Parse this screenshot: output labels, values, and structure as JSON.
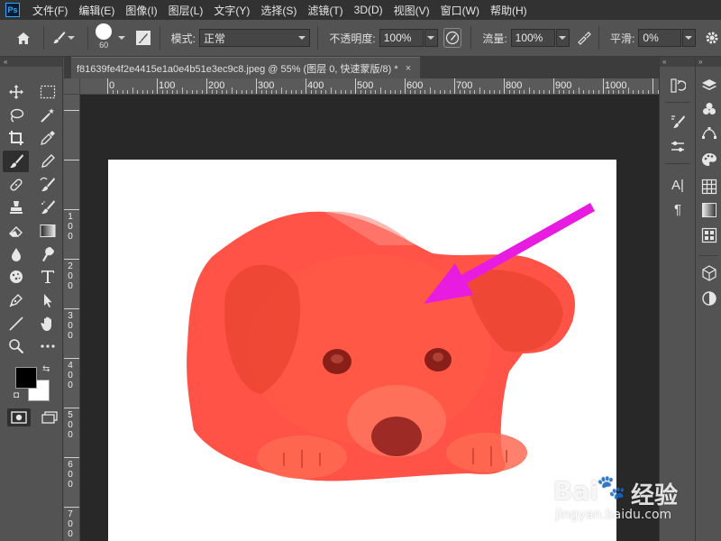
{
  "app": {
    "logo": "Ps",
    "menus": [
      "文件(F)",
      "编辑(E)",
      "图像(I)",
      "图层(L)",
      "文字(Y)",
      "选择(S)",
      "滤镜(T)",
      "3D(D)",
      "视图(V)",
      "窗口(W)",
      "帮助(H)"
    ]
  },
  "options": {
    "brush_size": "60",
    "mode_label": "模式:",
    "mode_value": "正常",
    "opacity_label": "不透明度:",
    "opacity_value": "100%",
    "flow_label": "流量:",
    "flow_value": "100%",
    "smooth_label": "平滑:",
    "smooth_value": "0%"
  },
  "document": {
    "tab_title": "f81639fe4f2e4415e1a0e4b51e3ec9c8.jpeg @ 55% (图层 0, 快速蒙版/8) *",
    "close": "×",
    "mask_overlay_color": "#ff4a3d",
    "annotation_arrow_color": "#e81ce0"
  },
  "rulers": {
    "top_labels": [
      "0",
      "100",
      "200",
      "300",
      "400",
      "500",
      "600",
      "700",
      "800",
      "900",
      "1000"
    ],
    "left_labels": [
      "1\n0\n0",
      "2\n0\n0",
      "3\n0\n0",
      "4\n0\n0",
      "5\n0\n0",
      "6\n0\n0",
      "7\n0\n0"
    ]
  },
  "toolbar": {
    "collapse": "«",
    "tools": [
      "move-icon",
      "marquee-icon",
      "lasso-icon",
      "magic-wand-icon",
      "crop-icon",
      "eyedropper-icon",
      "brush-icon",
      "pencil-icon",
      "stamp-icon",
      "history-brush-icon",
      "clone-stamp-icon",
      "smudge-icon",
      "eraser-icon",
      "gradient-icon",
      "blur-icon",
      "dodge-icon",
      "sponge-icon",
      "type-icon",
      "pen-icon",
      "path-select-icon",
      "line-icon",
      "hand-icon",
      "zoom-icon",
      "more-icon"
    ]
  },
  "panels": {
    "collapse": "«",
    "expand": "»",
    "type_glyph": "A|",
    "paragraph_glyph": "¶"
  },
  "watermark": {
    "brand": "Bai",
    "brand2": "经验",
    "url": "jingyan.baidu.com"
  }
}
